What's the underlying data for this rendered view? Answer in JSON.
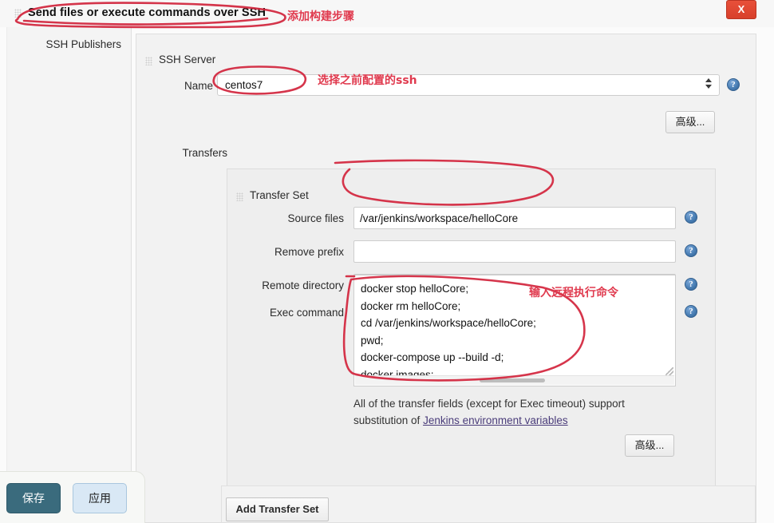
{
  "window": {
    "close_label": "X"
  },
  "step": {
    "title": "Send files or execute commands over SSH",
    "grip_icon": "drag-grip-icon"
  },
  "left_column": {
    "label": "SSH Publishers"
  },
  "ssh_server": {
    "section_label": "SSH Server",
    "name_label": "Name",
    "name_value": "centos7",
    "advanced_label": "高级...",
    "help_icon": "?"
  },
  "transfers": {
    "label": "Transfers",
    "transfer_set_label": "Transfer Set",
    "fields": [
      {
        "label": "Source files",
        "value": "/var/jenkins/workspace/helloCore"
      },
      {
        "label": "Remove prefix",
        "value": ""
      },
      {
        "label": "Remote directory",
        "value": ""
      }
    ],
    "exec_label": "Exec command",
    "exec_value": "docker stop helloCore;\ndocker rm helloCore;\ncd /var/jenkins/workspace/helloCore;\npwd;\ndocker-compose up --build -d;\ndocker images;",
    "description_part1": "All of the transfer fields (except for Exec timeout) support substitution of ",
    "description_link": "Jenkins environment variables",
    "advanced_label": "高级...",
    "add_transfer_set_label": "Add Transfer Set"
  },
  "footer": {
    "save_label": "保存",
    "apply_label": "应用"
  },
  "annotations": {
    "accent_color": "#d2243c",
    "items": [
      {
        "text": "添加构建步骤"
      },
      {
        "text": "选择之前配置的ssh"
      },
      {
        "text": "输入远程执行命令"
      }
    ]
  }
}
